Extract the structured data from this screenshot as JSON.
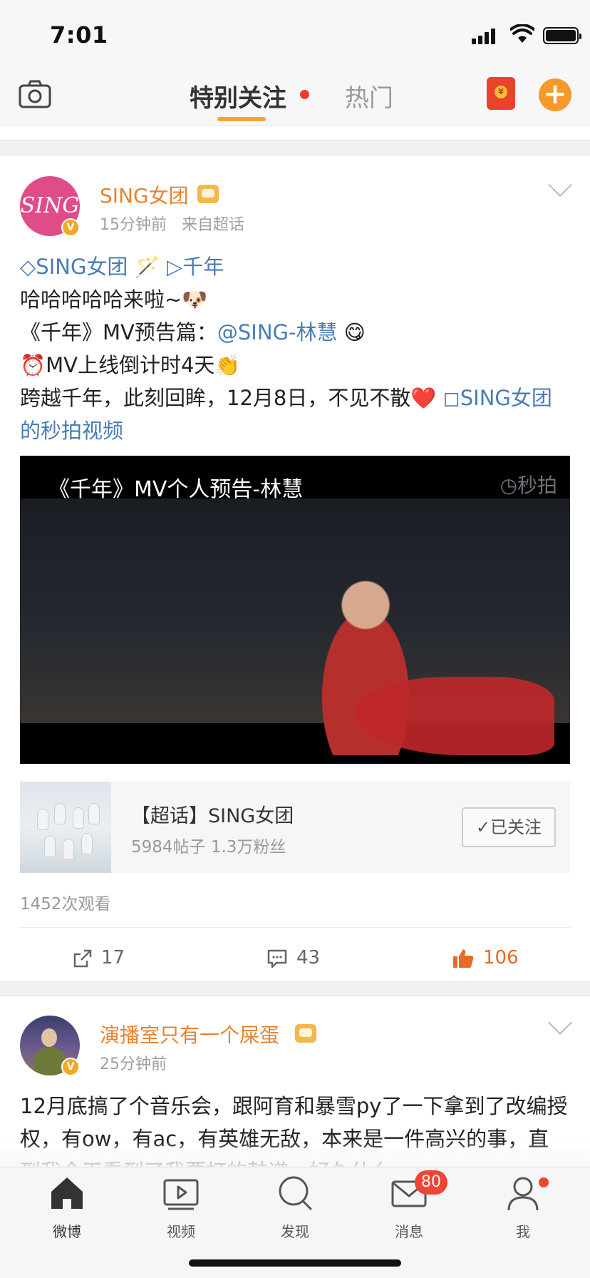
{
  "status_bar": {
    "time": "7:01"
  },
  "top_nav": {
    "tabs": [
      {
        "label": "特别关注"
      },
      {
        "label": "热门"
      }
    ],
    "redpacket_icon": "red-packet-icon"
  },
  "posts": [
    {
      "user": "SING女团",
      "avatar_text": "SING",
      "time": "15分钟前",
      "source": "来自超话",
      "lines": [
        {
          "prefix": "◇SING女团 🪄 ▷千年"
        },
        {
          "text": "哈哈哈哈哈来啦~🐶"
        },
        {
          "text": "《千年》MV预告篇：",
          "mention": "@SING-林慧",
          "suffix": " 😋"
        },
        {
          "text": "⏰MV上线倒计时4天👏"
        },
        {
          "text": "跨越千年，此刻回眸，12月8日，不见不散❤️",
          "link": " ◻SING女团的秒拍视频"
        }
      ],
      "video": {
        "title": "《千年》MV个人预告-林慧",
        "watermark": "◷秒拍"
      },
      "topic": {
        "title": "【超话】SING女团",
        "stats": "5984帖子 1.3万粉丝",
        "follow_label": "✓已关注"
      },
      "views": "1452次观看",
      "actions": {
        "repost": "17",
        "comment": "43",
        "like": "106"
      }
    },
    {
      "user": "演播室只有一个屎蛋",
      "time": "25分钟前",
      "text": "12月底搞了个音乐会，跟阿育和暴雪py了一下拿到了改编授权，有ow，有ac，有英雄无敌，本来是一件高兴的事，直到我今天看到了我要打的鼓谱，好久什么"
    }
  ],
  "tab_bar": {
    "items": [
      {
        "label": "微博",
        "icon": "home-icon"
      },
      {
        "label": "视频",
        "icon": "video-icon"
      },
      {
        "label": "发现",
        "icon": "search-icon"
      },
      {
        "label": "消息",
        "icon": "mail-icon",
        "badge": "80"
      },
      {
        "label": "我",
        "icon": "profile-icon"
      }
    ]
  },
  "colors": {
    "accent": "#f5a532",
    "username": "#e8822f",
    "link": "#4a7bb7",
    "like": "#e8692a",
    "badge": "#f04434"
  }
}
